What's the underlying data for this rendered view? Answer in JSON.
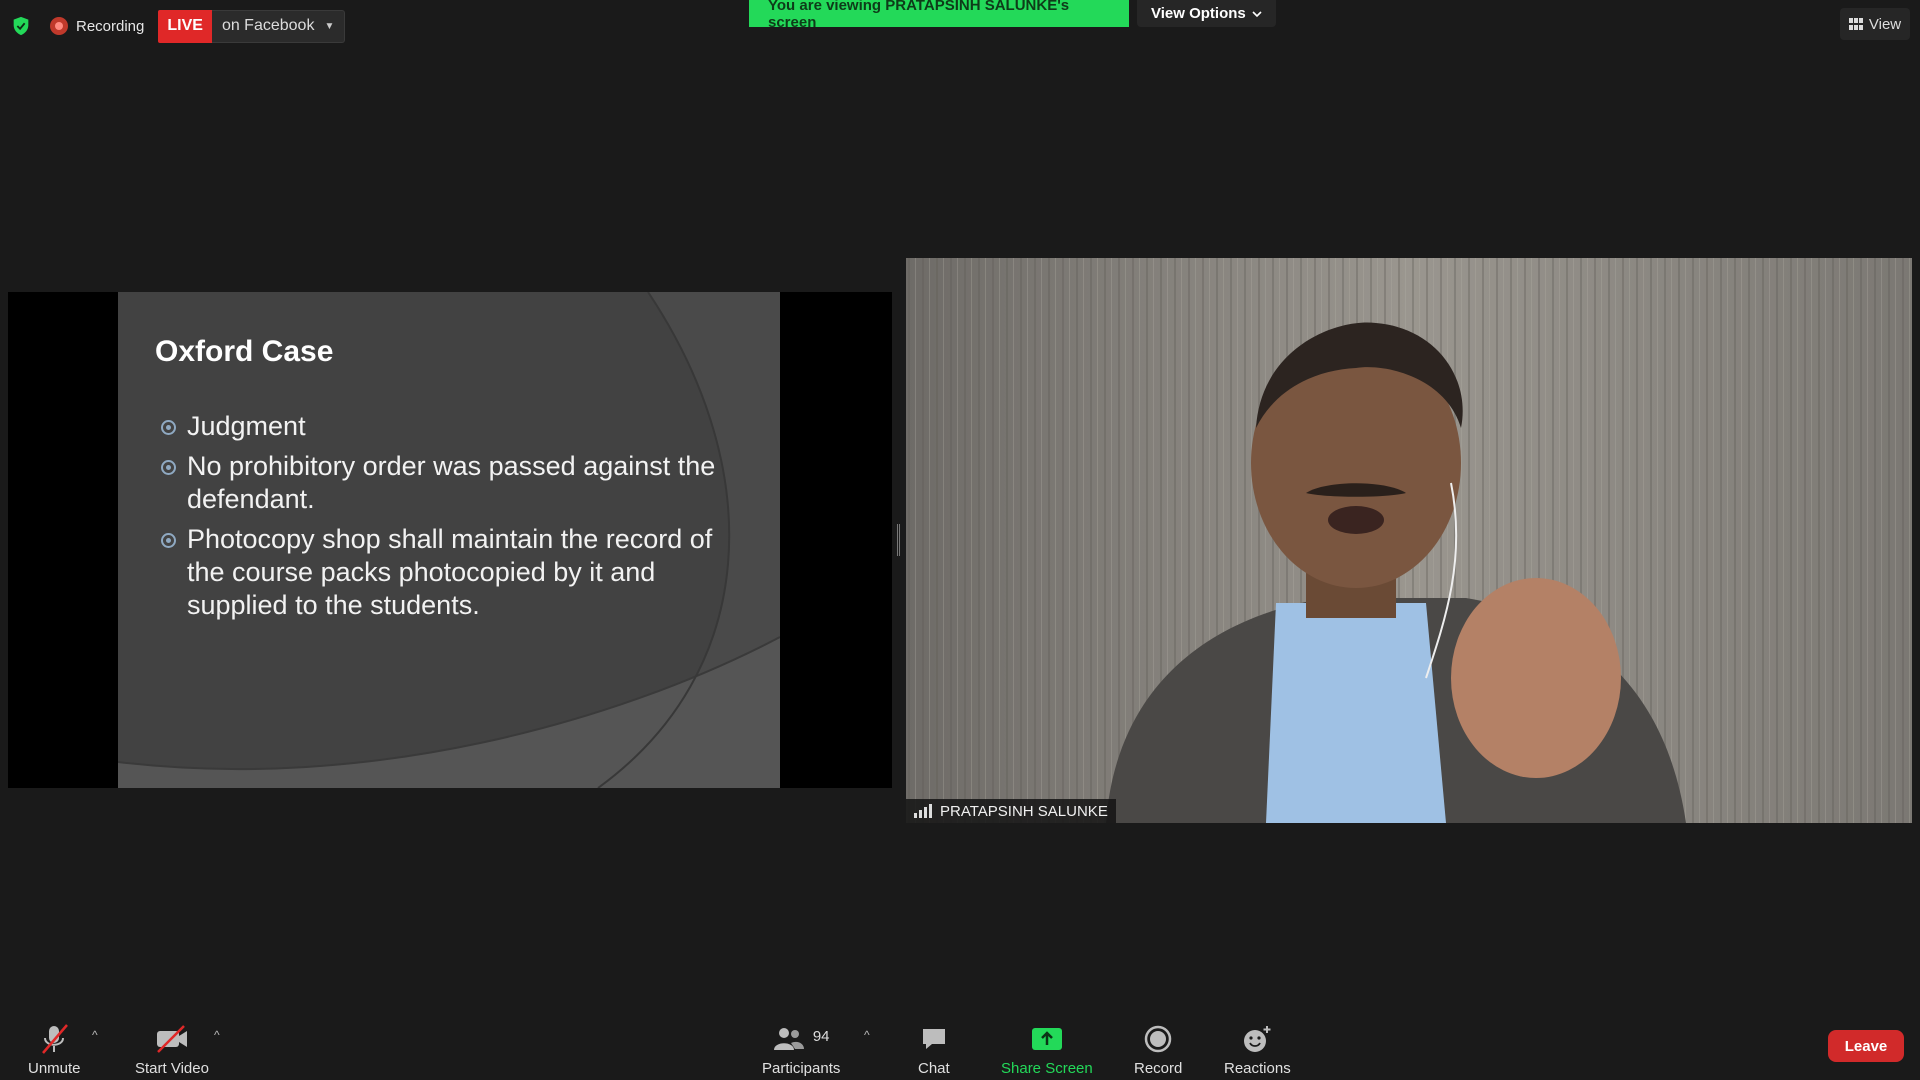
{
  "top_bar": {
    "recording_label": "Recording",
    "live_label": "LIVE",
    "live_destination": "on Facebook",
    "viewing_banner": "You are viewing PRATAPSINH SALUNKE's screen",
    "view_options_label": "View Options",
    "view_label": "View"
  },
  "slide": {
    "title": "Oxford Case",
    "bullets": [
      "Judgment",
      "No prohibitory order was passed against the defendant.",
      "Photocopy shop shall maintain the record of the course packs photocopied by it and supplied to the students."
    ]
  },
  "video": {
    "participant_name": "PRATAPSINH SALUNKE"
  },
  "toolbar": {
    "unmute_label": "Unmute",
    "start_video_label": "Start Video",
    "participants_label": "Participants",
    "participants_count": "94",
    "chat_label": "Chat",
    "share_screen_label": "Share Screen",
    "record_label": "Record",
    "reactions_label": "Reactions",
    "leave_label": "Leave"
  },
  "colors": {
    "accent_green": "#23d959",
    "live_red": "#e02828",
    "leave_red": "#d12a2a",
    "background": "#1a1a1a"
  },
  "icons": [
    "shield-icon",
    "recording-icon",
    "chevron-down-icon",
    "grid-icon",
    "signal-icon",
    "mic-muted-icon",
    "video-off-icon",
    "participants-icon",
    "chat-icon",
    "share-screen-icon",
    "record-icon",
    "reactions-icon"
  ]
}
